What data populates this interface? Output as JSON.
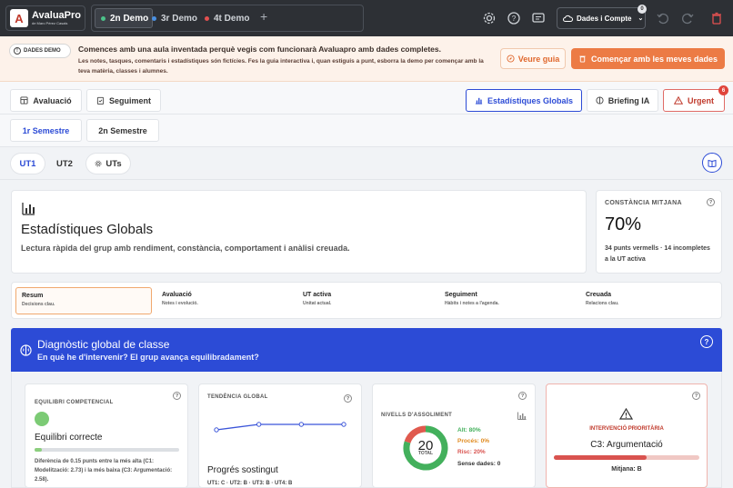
{
  "app": {
    "name": "AvaluaPro",
    "subtitle": "de Marc Pérez Casals",
    "logo_letter": "A"
  },
  "demo_tabs": [
    {
      "label": "2n Demo",
      "color": "#4cc38a",
      "active": true
    },
    {
      "label": "3r Demo",
      "color": "#4a90e2",
      "active": false
    },
    {
      "label": "4t Demo",
      "color": "#e25050",
      "active": false
    }
  ],
  "toolbar": {
    "data_button": "Dades i Compte",
    "data_badge": "0"
  },
  "banner": {
    "pill": "DADES DEMO",
    "title": "Comences amb una aula inventada perquè vegis com funcionarà Avaluapro amb dades completes.",
    "text": "Les notes, tasques, comentaris i estadístiques són fictícies. Fes la guia interactiva i, quan estiguis a punt, esborra la demo per començar amb la teva matèria, classes i alumnes.",
    "guide_button": "Veure guia",
    "start_button": "Començar amb les meves dades"
  },
  "main_tabs": {
    "avaluacio": "Avaluació",
    "seguiment": "Seguiment",
    "estadistiques": "Estadístiques Globals",
    "briefing": "Briefing IA",
    "urgent": "Urgent",
    "urgent_badge": "6"
  },
  "semesters": [
    "1r Semestre",
    "2n Semestre"
  ],
  "units": [
    "UT1",
    "UT2",
    "UTs"
  ],
  "hero": {
    "title": "Estadístiques Globals",
    "subtitle": "Lectura ràpida del grup amb rendiment, constància, comportament i anàlisi creuada."
  },
  "kpi": {
    "label": "CONSTÀNCIA MITJANA",
    "value": "70%",
    "note": "34 punts vermells · 14 incompletes a la UT activa"
  },
  "sub_tabs": [
    {
      "title": "Resum",
      "desc": "Decisions clau."
    },
    {
      "title": "Avaluació",
      "desc": "Notes i evolució."
    },
    {
      "title": "UT activa",
      "desc": "Unitat actual."
    },
    {
      "title": "Seguiment",
      "desc": "Hàbits i notes a l'agenda."
    },
    {
      "title": "Creuada",
      "desc": "Relacions clau."
    }
  ],
  "diagnostic": {
    "title": "Diagnòstic global de classe",
    "subtitle": "En què he d'intervenir? El grup avança equilibradament?"
  },
  "card_equilibri": {
    "label": "EQUILIBRI COMPETENCIAL",
    "title": "Equilibri correcte",
    "progress": 0.05,
    "text": "Diferència de 0.15 punts entre la més alta (C1: Modelització: 2.73) i la més baixa (C3: Argumentació: 2.58)."
  },
  "card_tendencia": {
    "label": "TENDÈNCIA GLOBAL",
    "title": "Progrés sostingut",
    "text": "UT1: C · UT2: B · UT3: B · UT4: B"
  },
  "card_nivells": {
    "label": "NIVELLS D'ASSOLIMENT",
    "total": "20",
    "total_label": "TOTAL",
    "alt": "Alt: 80%",
    "proces": "Procés: 0%",
    "risc": "Risc: 20%",
    "sense": "Sense dades: 0"
  },
  "card_intervencio": {
    "label": "INTERVENCIÓ PRIORITÀRIA",
    "title": "C3: Argumentació",
    "mean": "Mitjana: B",
    "progress": 0.64
  },
  "chart_data": {
    "type": "pie",
    "categories": [
      "Alt",
      "Procés",
      "Risc"
    ],
    "values": [
      80,
      0,
      20
    ],
    "colors": [
      "#43b05c",
      "#f0a030",
      "#e05a4e"
    ]
  },
  "trend_data": {
    "type": "line",
    "categories": [
      "UT1",
      "UT2",
      "UT3",
      "UT4"
    ],
    "values": [
      "C",
      "B",
      "B",
      "B"
    ]
  },
  "colors": {
    "accent": "#2c4bd6",
    "orange": "#ec7b45",
    "danger": "#d9534f",
    "success": "#43b05c"
  }
}
